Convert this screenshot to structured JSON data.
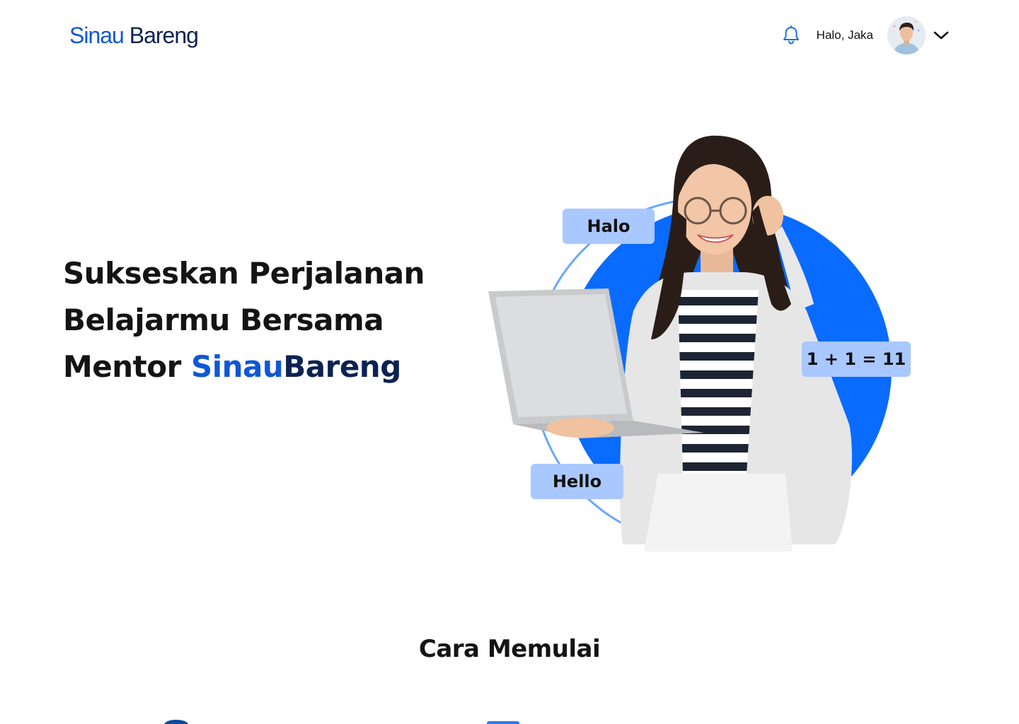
{
  "header": {
    "logo_part1": "Sinau",
    "logo_part2": " Bareng",
    "greeting": "Halo, Jaka",
    "icons": {
      "notification": "bell-icon",
      "dropdown": "chevron-down-icon"
    }
  },
  "hero": {
    "line1": "Sukseskan Perjalanan",
    "line2": "Belajarmu Bersama",
    "line3_prefix": "Mentor ",
    "line3_brand1": "Sinau",
    "line3_brand2": "Bareng",
    "bubbles": {
      "halo": "Halo",
      "hello": "Hello",
      "math": "1 + 1 = 11"
    }
  },
  "section": {
    "title": "Cara Memulai"
  },
  "colors": {
    "brand_blue": "#0f57d6",
    "brand_navy": "#0c2352",
    "circle_blue": "#0a6bff",
    "bubble_bg": "#a9c8ff"
  }
}
